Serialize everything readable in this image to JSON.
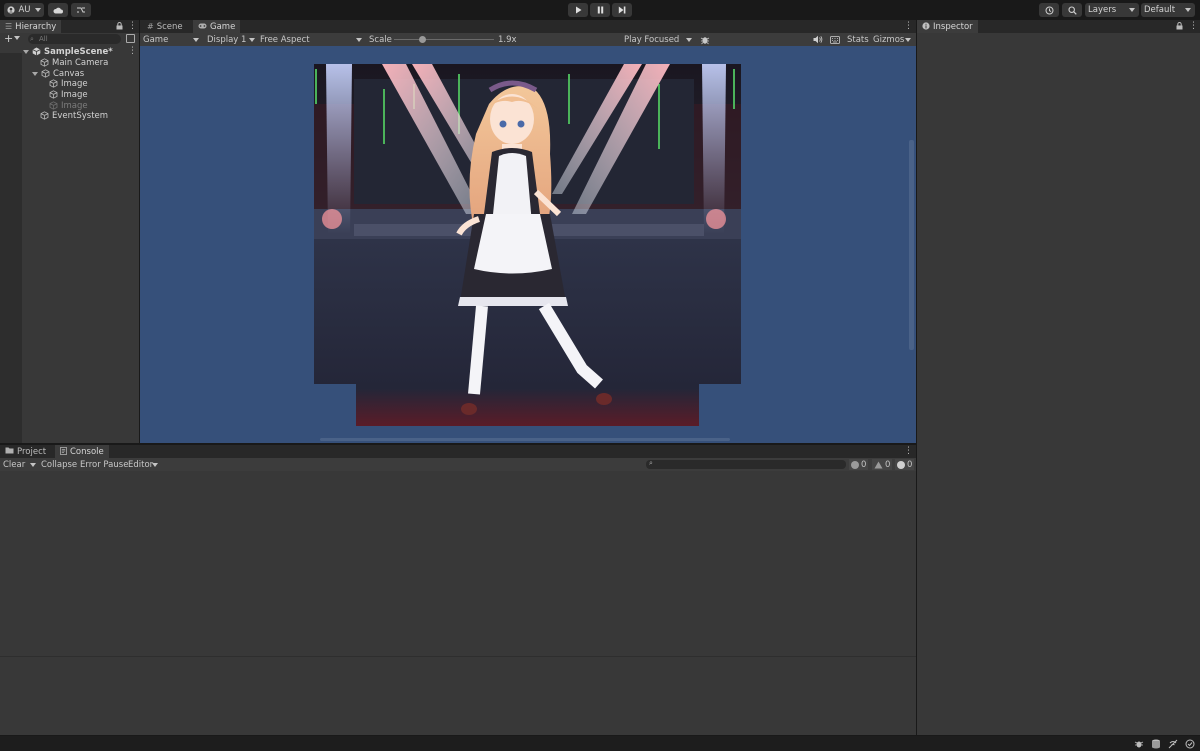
{
  "toolbar": {
    "account_label": "AU",
    "layers_label": "Layers",
    "layout_label": "Default"
  },
  "hierarchy": {
    "tab_label": "Hierarchy",
    "search_placeholder": "All",
    "items": [
      {
        "label": "SampleScene*"
      },
      {
        "label": "Main Camera"
      },
      {
        "label": "Canvas"
      },
      {
        "label": "Image"
      },
      {
        "label": "Image"
      },
      {
        "label": "Image"
      },
      {
        "label": "EventSystem"
      }
    ]
  },
  "game": {
    "tabs": [
      {
        "label": "Scene"
      },
      {
        "label": "Game"
      }
    ],
    "mode_label": "Game",
    "display_label": "Display 1",
    "aspect_label": "Free Aspect",
    "scale_label": "Scale",
    "scale_value": "1.9x",
    "scale_fraction": 0.28,
    "play_mode_label": "Play Focused",
    "stats_label": "Stats",
    "gizmos_label": "Gizmos"
  },
  "inspector": {
    "tab_label": "Inspector"
  },
  "console": {
    "tabs": [
      {
        "label": "Project"
      },
      {
        "label": "Console"
      }
    ],
    "clear_label": "Clear",
    "collapse_label": "Collapse",
    "error_pause_label": "Error Pause",
    "editor_label": "Editor",
    "log_count": "0",
    "warning_count": "0",
    "error_count": "0"
  },
  "colors": {
    "game_background": "#36507a",
    "panel": "#383838",
    "toolbar": "#191919"
  }
}
